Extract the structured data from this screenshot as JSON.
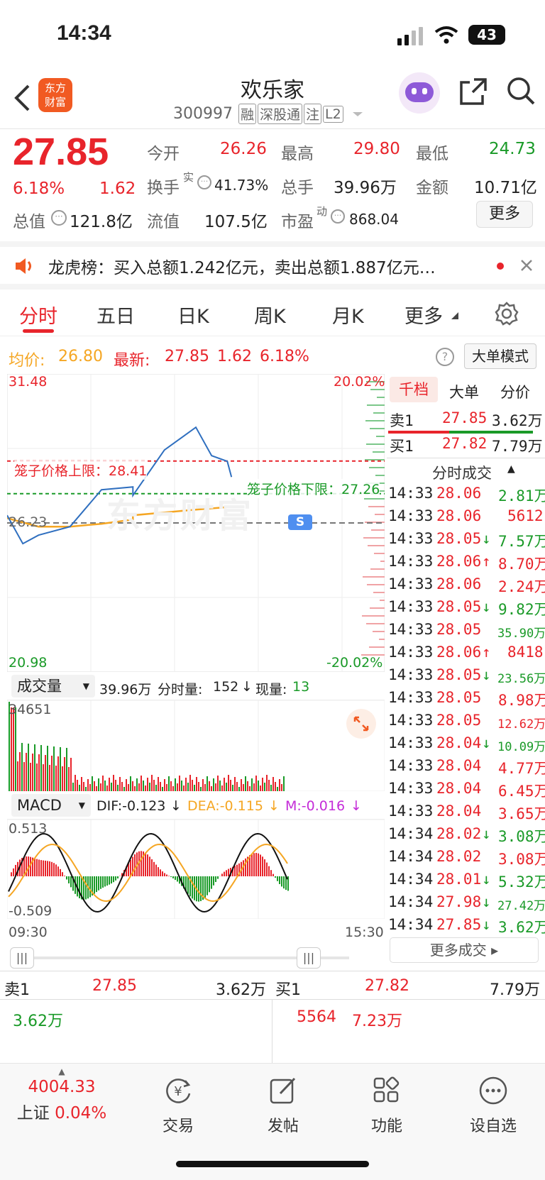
{
  "status_bar": {
    "time": "14:34",
    "battery": "43"
  },
  "header": {
    "title": "欢乐家",
    "code": "300997",
    "tags": [
      "融",
      "深股通",
      "注",
      "L2"
    ]
  },
  "quote": {
    "price": "27.85",
    "change_pct": "6.18%",
    "change": "1.62",
    "open_label": "今开",
    "open": "26.26",
    "high_label": "最高",
    "high": "29.80",
    "low_label": "最低",
    "low": "24.73",
    "turnover_label": "换手",
    "turnover_sup": "实",
    "turnover": "41.73%",
    "volume_label": "总手",
    "volume": "39.96万",
    "amount_label": "金额",
    "amount": "10.71亿",
    "mktcap_label": "总值",
    "mktcap": "121.8亿",
    "float_label": "流值",
    "float": "107.5亿",
    "pe_label": "市盈",
    "pe_sup": "动",
    "pe": "868.04",
    "more_label": "更多"
  },
  "notice": {
    "text": "龙虎榜：买入总额1.242亿元，卖出总额1.887亿元…"
  },
  "tabs": [
    "分时",
    "五日",
    "日K",
    "周K",
    "月K",
    "更多"
  ],
  "avg_bar": {
    "avg_label": "均价:",
    "avg": "26.80",
    "latest_label": "最新:",
    "latest": "27.85",
    "chg": "1.62",
    "pct": "6.18%",
    "mode": "大单模式"
  },
  "chart": {
    "ymax": "31.48",
    "ymin": "20.98",
    "pct_max": "20.02%",
    "pct_min": "-20.02%",
    "upper_label": "笼子价格上限：28.41",
    "lower_label": "笼子价格下限：27.26",
    "prev_close": "26.23",
    "watermark": "东方财富",
    "vol_selector": "成交量",
    "vol_total": "39.96万",
    "vol_sep_label": "分时量:",
    "vol_sep": "152",
    "cur_label": "现量:",
    "cur": "13",
    "vol_max": "34651",
    "macd_selector": "MACD",
    "dif": "DIF:-0.123",
    "dea": "DEA:-0.115",
    "m": "M:-0.016",
    "macd_max": "0.513",
    "macd_min": "-0.509",
    "time_start": "09:30",
    "time_end": "15:30",
    "s_marker": "S"
  },
  "chart_data": {
    "type": "line",
    "x_range": [
      "09:30",
      "15:30"
    ],
    "ylim": [
      20.98,
      31.48
    ],
    "series": [
      {
        "name": "最新",
        "x": [
          "09:30",
          "09:45",
          "10:00",
          "10:30",
          "11:00",
          "11:30",
          "13:00",
          "13:30",
          "14:00",
          "14:15",
          "14:30",
          "14:34"
        ],
        "values": [
          26.5,
          25.5,
          25.8,
          26.1,
          27.4,
          27.5,
          27.2,
          28.8,
          29.6,
          28.6,
          28.4,
          27.85
        ]
      },
      {
        "name": "均价",
        "x": [
          "09:30",
          "10:00",
          "10:30",
          "11:00",
          "11:30",
          "13:00",
          "13:30",
          "14:00",
          "14:34"
        ],
        "values": [
          26.4,
          26.1,
          26.1,
          26.2,
          26.35,
          26.5,
          26.6,
          26.7,
          26.8
        ]
      }
    ]
  },
  "orderbook": {
    "tab_a": "千档",
    "tab_b": "大单",
    "tab_c": "分价",
    "sell1_label": "卖1",
    "sell1_price": "27.85",
    "sell1_vol": "3.62万",
    "buy1_label": "买1",
    "buy1_price": "27.82",
    "buy1_vol": "7.79万",
    "ticks_title": "分时成交",
    "more_ticks": "更多成交"
  },
  "ticks": [
    {
      "t": "14:33",
      "p": "28.06",
      "a": "",
      "v": "2.81万",
      "vc": "green"
    },
    {
      "t": "14:33",
      "p": "28.06",
      "a": "",
      "v": "5612",
      "vc": "red"
    },
    {
      "t": "14:33",
      "p": "28.05",
      "a": "↓",
      "v": "7.57万",
      "vc": "green"
    },
    {
      "t": "14:33",
      "p": "28.06",
      "a": "↑",
      "v": "8.70万",
      "vc": "red"
    },
    {
      "t": "14:33",
      "p": "28.06",
      "a": "",
      "v": "2.24万",
      "vc": "red"
    },
    {
      "t": "14:33",
      "p": "28.05",
      "a": "↓",
      "v": "9.82万",
      "vc": "green"
    },
    {
      "t": "14:33",
      "p": "28.05",
      "a": "",
      "v": "35.90万",
      "vc": "green"
    },
    {
      "t": "14:33",
      "p": "28.06",
      "a": "↑",
      "v": "8418",
      "vc": "red"
    },
    {
      "t": "14:33",
      "p": "28.05",
      "a": "↓",
      "v": "23.56万",
      "vc": "green"
    },
    {
      "t": "14:33",
      "p": "28.05",
      "a": "",
      "v": "8.98万",
      "vc": "red"
    },
    {
      "t": "14:33",
      "p": "28.05",
      "a": "",
      "v": "12.62万",
      "vc": "red"
    },
    {
      "t": "14:33",
      "p": "28.04",
      "a": "↓",
      "v": "10.09万",
      "vc": "green"
    },
    {
      "t": "14:33",
      "p": "28.04",
      "a": "",
      "v": "4.77万",
      "vc": "red"
    },
    {
      "t": "14:33",
      "p": "28.04",
      "a": "",
      "v": "6.45万",
      "vc": "red"
    },
    {
      "t": "14:33",
      "p": "28.04",
      "a": "",
      "v": "3.65万",
      "vc": "red"
    },
    {
      "t": "14:34",
      "p": "28.02",
      "a": "↓",
      "v": "3.08万",
      "vc": "green"
    },
    {
      "t": "14:34",
      "p": "28.02",
      "a": "",
      "v": "3.08万",
      "vc": "red"
    },
    {
      "t": "14:34",
      "p": "28.01",
      "a": "↓",
      "v": "5.32万",
      "vc": "green"
    },
    {
      "t": "14:34",
      "p": "27.98",
      "a": "↓",
      "v": "27.42万",
      "vc": "green"
    },
    {
      "t": "14:34",
      "p": "27.85",
      "a": "↓",
      "v": "3.62万",
      "vc": "green"
    }
  ],
  "bottom_book": {
    "sell_label": "卖1",
    "sell_price": "27.85",
    "sell_vol": "3.62万",
    "sell_sub": "3.62万",
    "buy_label": "买1",
    "buy_price": "27.82",
    "buy_vol": "7.79万",
    "buy_sub_a": "5564",
    "buy_sub_b": "7.23万"
  },
  "nav": {
    "index_value": "4004.33",
    "index_name": "上证",
    "index_pct": "0.04%",
    "trade": "交易",
    "post": "发帖",
    "func": "功能",
    "watch": "设自选"
  },
  "colors": {
    "up": "#e8242b",
    "down": "#1a9a28",
    "avg": "#f5a623",
    "price_line": "#2f6fbf"
  }
}
